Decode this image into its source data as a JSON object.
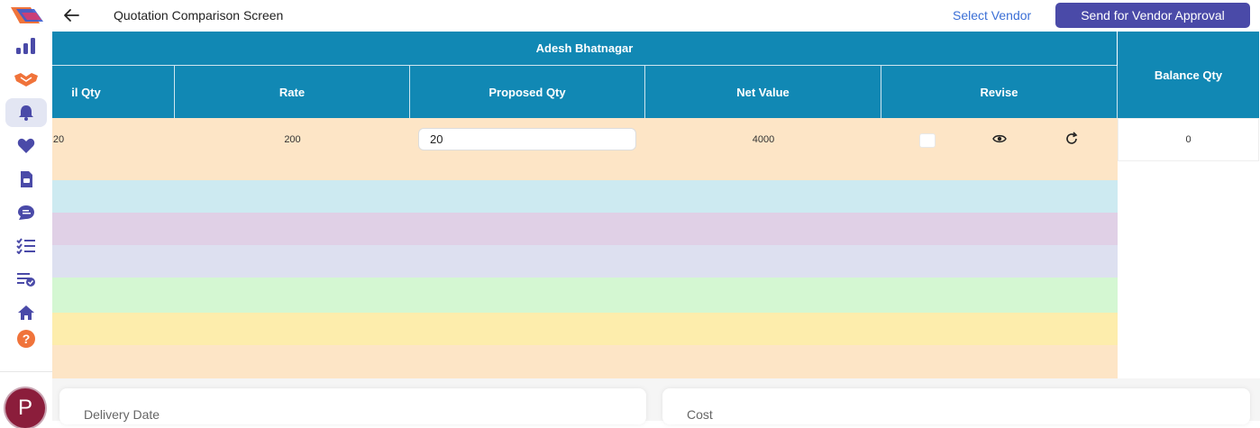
{
  "header": {
    "title": "Quotation Comparison Screen",
    "select_vendor": "Select Vendor",
    "send_button": "Send for Vendor Approval"
  },
  "sidebar": {
    "items": [
      {
        "icon": "bar-chart-icon"
      },
      {
        "icon": "handshake-icon"
      },
      {
        "icon": "bell-icon",
        "active": true
      },
      {
        "icon": "heart-icon"
      },
      {
        "icon": "document-icon"
      },
      {
        "icon": "chat-list-icon"
      },
      {
        "icon": "checklist-icon"
      },
      {
        "icon": "approved-list-icon"
      },
      {
        "icon": "home-icon"
      },
      {
        "icon": "help-icon"
      }
    ],
    "avatar_initial": "P"
  },
  "table": {
    "vendor_name": "Adesh Bhatnagar",
    "columns": [
      "il Qty",
      "Rate",
      "Proposed Qty",
      "Net Value",
      "Revise"
    ],
    "balance_header": "Balance Qty",
    "row": {
      "avail_qty": "20",
      "rate": "200",
      "proposed_qty": "20",
      "net_value": "4000",
      "balance_qty": "0"
    }
  },
  "bands": [
    "#cdeaf1",
    "#e0d0e6",
    "#dde0f0",
    "#d4f7d2",
    "#fdedac",
    "#fde5c6"
  ],
  "cards": {
    "delivery_label": "Delivery Date",
    "cost_label": "Cost"
  },
  "colors": {
    "header_blue": "#1188b4",
    "primary": "#4a4aa8",
    "link": "#3b6fd6",
    "row_peach": "#fde5c6"
  }
}
